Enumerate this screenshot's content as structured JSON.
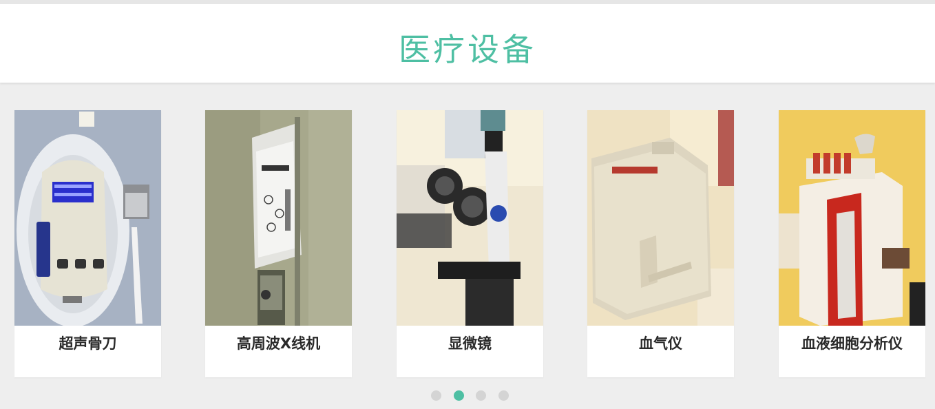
{
  "header": {
    "title": "医疗设备",
    "title_color": "#4ebfa3"
  },
  "products": [
    {
      "label": "超声骨刀",
      "image_icon": "ultrasonic-bone-knife-photo"
    },
    {
      "label": "高周波X线机",
      "image_icon": "high-frequency-xray-machine-photo"
    },
    {
      "label": "显微镜",
      "image_icon": "microscope-photo"
    },
    {
      "label": "血气仪",
      "image_icon": "blood-gas-analyzer-photo"
    },
    {
      "label": "血液细胞分析仪",
      "image_icon": "hematology-analyzer-photo"
    }
  ],
  "pagination": {
    "total": 4,
    "active_index": 1,
    "active_color": "#4ebfa3",
    "inactive_color": "#d4d4d4"
  }
}
